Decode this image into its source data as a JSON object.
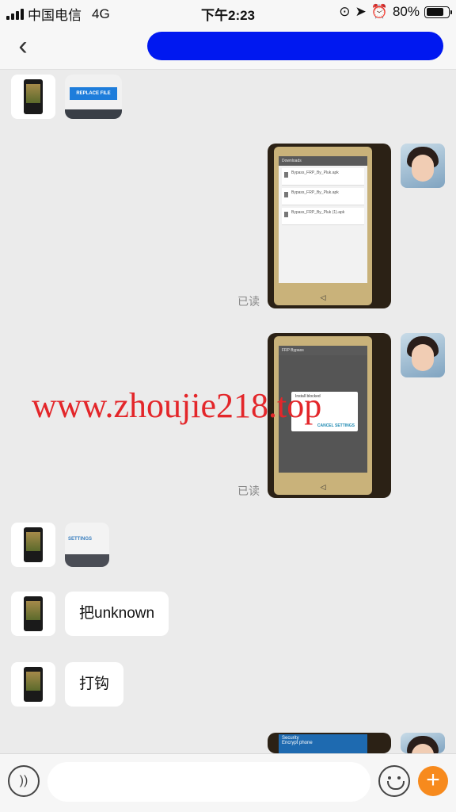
{
  "status_bar": {
    "carrier": "中国电信",
    "network": "4G",
    "time": "下午2:23",
    "battery_text": "80%",
    "battery_level": 0.8
  },
  "nav": {
    "back_icon": "chevron-left-icon"
  },
  "messages": [
    {
      "side": "left",
      "kind": "image",
      "image_text": "REPLACE FILE"
    },
    {
      "side": "right",
      "kind": "image",
      "image_text": {
        "header": "Downloads",
        "items": [
          "Bypass_FRP_By_Pluk.apk",
          "Bypass_FRP_By_Pluk.apk",
          "Bypass_FRP_By_Pluk (1).apk"
        ]
      },
      "read_label": "已读"
    },
    {
      "side": "right",
      "kind": "image",
      "image_text": {
        "title": "FRP Bypass",
        "dialog_title": "Install blocked",
        "dialog_buttons": "CANCEL  SETTINGS"
      },
      "read_label": "已读"
    },
    {
      "side": "left",
      "kind": "image",
      "image_text": "SETTINGS"
    },
    {
      "side": "left",
      "kind": "text",
      "text": "把unknown"
    },
    {
      "side": "left",
      "kind": "text",
      "text": "打钩"
    },
    {
      "side": "right",
      "kind": "image",
      "image_text": {
        "header": "Security",
        "line": "Encrypt phone"
      }
    }
  ],
  "watermark": "www.zhoujie218.top",
  "input_bar": {
    "voice_icon": "voice-icon",
    "input_value": "",
    "emoji_icon": "emoji-icon",
    "plus_icon": "plus-icon",
    "accent_color": "#f78a1d"
  }
}
